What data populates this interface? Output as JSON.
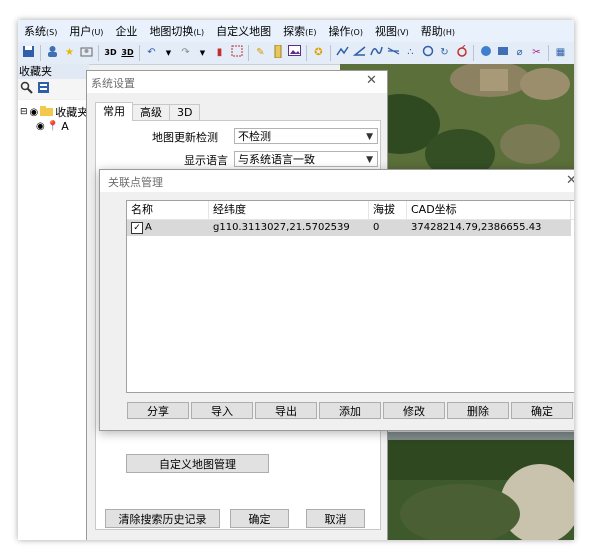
{
  "menu": [
    {
      "label": "系统",
      "accel": "(S)"
    },
    {
      "label": "用户",
      "accel": "(U)"
    },
    {
      "label": "企业",
      "accel": ""
    },
    {
      "label": "地图切换",
      "accel": "(L)"
    },
    {
      "label": "自定义地图",
      "accel": ""
    },
    {
      "label": "探索",
      "accel": "(E)"
    },
    {
      "label": "操作",
      "accel": "(O)"
    },
    {
      "label": "视图",
      "accel": "(V)"
    },
    {
      "label": "帮助",
      "accel": "(H)"
    }
  ],
  "toolbar": {
    "label_3d": "3D",
    "label_3d_stack": "3D"
  },
  "favorites_panel": {
    "title": "收藏夹",
    "root_label": "收藏夹",
    "item_label": "A"
  },
  "system_settings": {
    "title": "系统设置",
    "tabs": [
      "常用",
      "高级",
      "3D"
    ],
    "map_update_label": "地图更新检测",
    "map_update_value": "不检测",
    "language_label": "显示语言",
    "language_value": "与系统语言一致",
    "custom_map_button": "自定义地图管理",
    "clear_history_button": "清除搜索历史记录",
    "ok_button": "确定",
    "cancel_button": "取消"
  },
  "related_points": {
    "title": "关联点管理",
    "columns": [
      "名称",
      "经纬度",
      "海拔",
      "CAD坐标"
    ],
    "rows": [
      {
        "checked": true,
        "name": "A",
        "latlng": "g110.3113027,21.5702539",
        "altitude": "0",
        "cad": "37428214.79,2386655.43"
      }
    ],
    "buttons": [
      "分享",
      "导入",
      "导出",
      "添加",
      "修改",
      "删除",
      "确定"
    ]
  }
}
